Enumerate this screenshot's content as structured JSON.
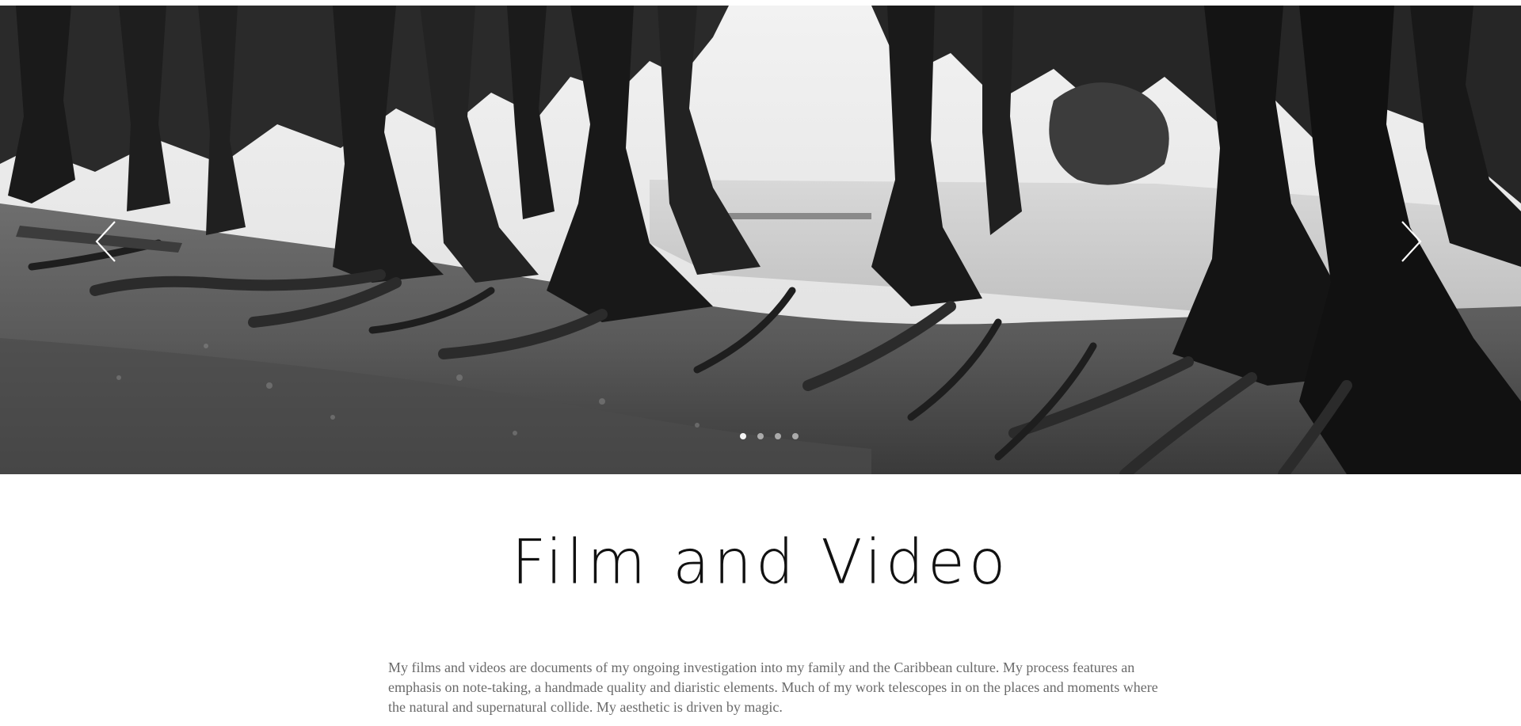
{
  "page": {
    "title": "Film and Video",
    "description": "My films and videos are documents of my ongoing investigation into my family and the Caribbean culture. My process features an emphasis on note-taking, a handmade quality and diaristic elements. Much of my work telescopes in on the places and moments where the natural and supernatural collide. My aesthetic is driven by magic."
  },
  "slideshow": {
    "image_subject": "black-and-white photo of large trees with exposed roots by a river",
    "prev_icon": "chevron-left-icon",
    "next_icon": "chevron-right-icon",
    "slide_count": 4,
    "active_slide": 1
  },
  "colors": {
    "title": "#111111",
    "body_text": "#6a6a6a",
    "background": "#ffffff",
    "arrow": "#ffffff"
  }
}
